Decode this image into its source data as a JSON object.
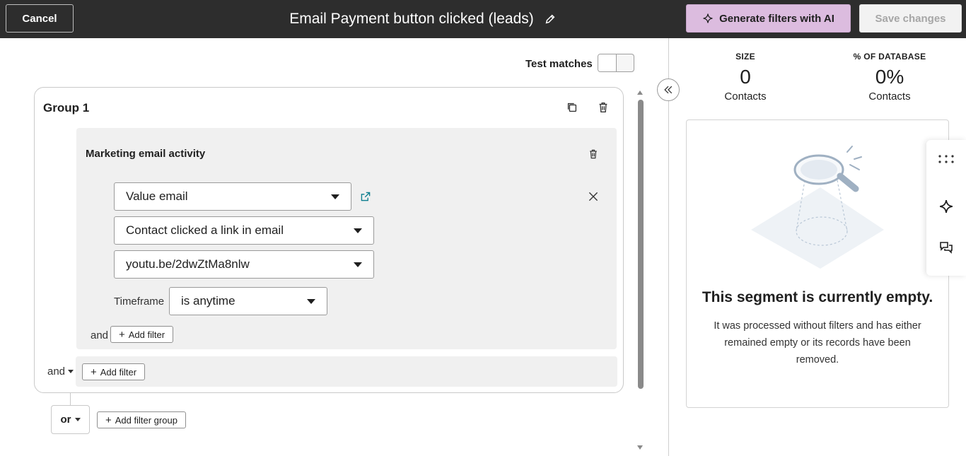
{
  "header": {
    "cancel_label": "Cancel",
    "title": "Email Payment button clicked (leads)",
    "ai_label": "Generate filters with AI",
    "save_label": "Save changes"
  },
  "test_matches": {
    "label": "Test matches",
    "enabled": false
  },
  "group": {
    "title": "Group 1",
    "filter": {
      "title": "Marketing email activity",
      "email_select": "Value email",
      "activity_select": "Contact clicked a link in email",
      "link_select": "youtu.be/2dwZtMa8nlw",
      "timeframe_label": "Timeframe",
      "timeframe_select": "is anytime",
      "and_label": "and",
      "add_filter_label": "Add filter"
    },
    "and_label": "and",
    "add_filter_label": "Add filter"
  },
  "or_label": "or",
  "add_group_label": "Add filter group",
  "stats": {
    "size_label": "SIZE",
    "size_value": "0",
    "size_sub": "Contacts",
    "percent_label": "% OF DATABASE",
    "percent_value": "0%",
    "percent_sub": "Contacts"
  },
  "empty": {
    "title": "This segment is currently empty.",
    "description": "It was processed without filters and has either remained empty or its records have been removed."
  },
  "colors": {
    "header_bg": "#2d2d2d",
    "ai_button_bg": "#dcbcdf",
    "link_icon": "#0b7d8e",
    "panel_bg": "#f0f0f0"
  }
}
